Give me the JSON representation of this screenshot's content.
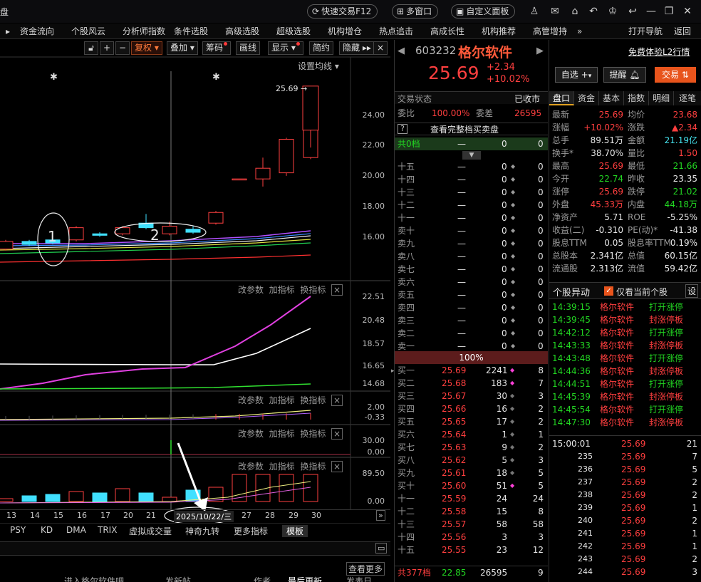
{
  "titlebar": {
    "left_glyph": "盘",
    "quick_trade": "快速交易F12",
    "multi_window": "多窗口",
    "custom_panel": "自定义面板"
  },
  "menu": [
    "资金流向",
    "个股风云",
    "分析师指数",
    "条件选股",
    "高级选股",
    "超级选股",
    "机构增仓",
    "热点追击",
    "高成长性",
    "机构推荐",
    "高管增持",
    "»",
    "打开导航",
    "返回"
  ],
  "chart_toolbar": {
    "fuquan": "复权",
    "diejia": "叠加",
    "chouma": "筹码",
    "huaxian": "画线",
    "xianshi": "显示",
    "jianyue": "简约",
    "yincang": "隐藏",
    "settings": "设置均线"
  },
  "price_axis": [
    "24.00",
    "22.00",
    "20.00",
    "18.00",
    "16.00"
  ],
  "price_marker": "25.69",
  "annotations": {
    "circle1": "1",
    "circle2": "2"
  },
  "panel_buttons": {
    "params": "改参数",
    "add": "加指标",
    "swap": "换指标",
    "close": "×"
  },
  "ind1_axis": [
    "22.51",
    "20.48",
    "18.57",
    "16.65",
    "14.68"
  ],
  "ind2_axis": [
    "2.00",
    "-0.33"
  ],
  "ind3_axis": [
    "30.00",
    "0.00"
  ],
  "ind4_axis": [
    "89.50",
    "0.00"
  ],
  "dates": [
    "13",
    "14",
    "15",
    "16",
    "17",
    "20",
    "21",
    "27",
    "28",
    "29",
    "30"
  ],
  "selected_date": "2025/10/22/三",
  "bottom_tabs": [
    "PSY",
    "KD",
    "DMA",
    "TRIX",
    "虚拟成交量",
    "神奇九转",
    "更多指标",
    "模板"
  ],
  "see_more": "查看更多",
  "bottom_cols": [
    "进入格尔软件吧",
    "发新帖",
    "作者",
    "最后更新",
    "发表日"
  ],
  "stock": {
    "code": "603232",
    "name": "格尔软件",
    "price": "25.69",
    "change": "+2.34",
    "pct": "+10.02%",
    "free_trial": "免费体验L2行情",
    "zixuan": "自选",
    "tixing": "提醒",
    "jiaoyi": "交易"
  },
  "status": {
    "label": "交易状态",
    "value": "已收市",
    "weibi_label": "委比",
    "weibi": "100.00%",
    "weicha_label": "委差",
    "weicha": "26595",
    "see_full": "查看完整档买卖盘",
    "total0_label": "共0档",
    "total0_a": "—",
    "total0_b": "0",
    "total0_c": "0"
  },
  "ask_rows": [
    {
      "l": "十五",
      "p": "—",
      "v": "0",
      "c": "0"
    },
    {
      "l": "十四",
      "p": "—",
      "v": "0",
      "c": "0"
    },
    {
      "l": "十三",
      "p": "—",
      "v": "0",
      "c": "0"
    },
    {
      "l": "十二",
      "p": "—",
      "v": "0",
      "c": "0"
    },
    {
      "l": "十一",
      "p": "—",
      "v": "0",
      "c": "0"
    },
    {
      "l": "卖十",
      "p": "—",
      "v": "0",
      "c": "0"
    },
    {
      "l": "卖九",
      "p": "—",
      "v": "0",
      "c": "0"
    },
    {
      "l": "卖八",
      "p": "—",
      "v": "0",
      "c": "0"
    },
    {
      "l": "卖七",
      "p": "—",
      "v": "0",
      "c": "0"
    },
    {
      "l": "卖六",
      "p": "—",
      "v": "0",
      "c": "0"
    },
    {
      "l": "卖五",
      "p": "—",
      "v": "0",
      "c": "0"
    },
    {
      "l": "卖四",
      "p": "—",
      "v": "0",
      "c": "0"
    },
    {
      "l": "卖三",
      "p": "—",
      "v": "0",
      "c": "0"
    },
    {
      "l": "卖二",
      "p": "—",
      "v": "0",
      "c": "0"
    },
    {
      "l": "卖一",
      "p": "—",
      "v": "0",
      "c": "0"
    }
  ],
  "mid_pct": "100%",
  "bid_rows": [
    {
      "l": "买一",
      "p": "25.69",
      "v": "2241",
      "c": "8",
      "m": "pink"
    },
    {
      "l": "买二",
      "p": "25.68",
      "v": "183",
      "c": "7",
      "m": "pink"
    },
    {
      "l": "买三",
      "p": "25.67",
      "v": "30",
      "c": "3",
      "m": "gray"
    },
    {
      "l": "买四",
      "p": "25.66",
      "v": "16",
      "c": "2",
      "m": "gray"
    },
    {
      "l": "买五",
      "p": "25.65",
      "v": "17",
      "c": "2",
      "m": "gray"
    },
    {
      "l": "买六",
      "p": "25.64",
      "v": "1",
      "c": "1",
      "m": "gray"
    },
    {
      "l": "买七",
      "p": "25.63",
      "v": "9",
      "c": "2",
      "m": "gray"
    },
    {
      "l": "买八",
      "p": "25.62",
      "v": "5",
      "c": "3",
      "m": "gray"
    },
    {
      "l": "买九",
      "p": "25.61",
      "v": "18",
      "c": "5",
      "m": "gray"
    },
    {
      "l": "买十",
      "p": "25.60",
      "v": "51",
      "c": "5",
      "m": "pink"
    },
    {
      "l": "十一",
      "p": "25.59",
      "v": "24",
      "c": "24",
      "m": ""
    },
    {
      "l": "十二",
      "p": "25.58",
      "v": "15",
      "c": "8",
      "m": ""
    },
    {
      "l": "十三",
      "p": "25.57",
      "v": "58",
      "c": "58",
      "m": ""
    },
    {
      "l": "十四",
      "p": "25.56",
      "v": "3",
      "c": "3",
      "m": ""
    },
    {
      "l": "十五",
      "p": "25.55",
      "v": "23",
      "c": "12",
      "m": ""
    }
  ],
  "total_bid": {
    "label": "共377档",
    "a": "22.85",
    "b": "26595",
    "c": "9"
  },
  "quote_tabs": [
    "盘口",
    "资金",
    "基本",
    "指数",
    "明细",
    "逐笔"
  ],
  "quote": [
    {
      "l1": "最新",
      "v1": "25.69",
      "c1": "red",
      "l2": "均价",
      "v2": "23.68",
      "c2": "red"
    },
    {
      "l1": "涨幅",
      "v1": "+10.02%",
      "c1": "red",
      "l2": "涨跌",
      "v2": "▲2.34",
      "c2": "red"
    },
    {
      "l1": "总手",
      "v1": "89.51万",
      "c1": "white",
      "l2": "金额",
      "v2": "21.19亿",
      "c2": "cyan"
    },
    {
      "l1": "换手*",
      "v1": "38.70%",
      "c1": "white",
      "l2": "量比",
      "v2": "1.50",
      "c2": "red"
    },
    {
      "l1": "最高",
      "v1": "25.69",
      "c1": "red",
      "l2": "最低",
      "v2": "21.66",
      "c2": "green"
    },
    {
      "l1": "今开",
      "v1": "22.74",
      "c1": "green",
      "l2": "昨收",
      "v2": "23.35",
      "c2": "white"
    },
    {
      "l1": "涨停",
      "v1": "25.69",
      "c1": "red",
      "l2": "跌停",
      "v2": "21.02",
      "c2": "green"
    },
    {
      "l1": "外盘",
      "v1": "45.33万",
      "c1": "red",
      "l2": "内盘",
      "v2": "44.18万",
      "c2": "green"
    },
    {
      "l1": "净资产",
      "v1": "5.71",
      "c1": "white",
      "l2": "ROE",
      "v2": "-5.25%",
      "c2": "white"
    },
    {
      "l1": "收益(二)",
      "v1": "-0.310",
      "c1": "white",
      "l2": "PE(动)*",
      "v2": "-41.38",
      "c2": "white"
    },
    {
      "l1": "股息TTM",
      "v1": "0.05",
      "c1": "white",
      "l2": "股息率TTM",
      "v2": "0.19%",
      "c2": "white"
    },
    {
      "l1": "总股本",
      "v1": "2.341亿",
      "c1": "white",
      "l2": "总值",
      "v2": "60.15亿",
      "c2": "white"
    },
    {
      "l1": "流通股",
      "v1": "2.313亿",
      "c1": "white",
      "l2": "流值",
      "v2": "59.42亿",
      "c2": "white"
    }
  ],
  "movement": {
    "title": "个股异动",
    "only_current": "仅看当前个股",
    "settings": "设"
  },
  "movements": [
    {
      "t": "14:39:15",
      "n": "格尔软件",
      "e": "打开涨停",
      "c": "green"
    },
    {
      "t": "14:39:45",
      "n": "格尔软件",
      "e": "封涨停板",
      "c": "red"
    },
    {
      "t": "14:42:12",
      "n": "格尔软件",
      "e": "打开涨停",
      "c": "green"
    },
    {
      "t": "14:43:33",
      "n": "格尔软件",
      "e": "封涨停板",
      "c": "red"
    },
    {
      "t": "14:43:48",
      "n": "格尔软件",
      "e": "打开涨停",
      "c": "green"
    },
    {
      "t": "14:44:36",
      "n": "格尔软件",
      "e": "封涨停板",
      "c": "red"
    },
    {
      "t": "14:44:51",
      "n": "格尔软件",
      "e": "打开涨停",
      "c": "green"
    },
    {
      "t": "14:45:39",
      "n": "格尔软件",
      "e": "封涨停板",
      "c": "red"
    },
    {
      "t": "14:45:54",
      "n": "格尔软件",
      "e": "打开涨停",
      "c": "green"
    },
    {
      "t": "14:47:30",
      "n": "格尔软件",
      "e": "封涨停板",
      "c": "red"
    }
  ],
  "ticks": [
    {
      "t": "15:00:01",
      "p": "25.69",
      "v": "21"
    },
    {
      "t": "235",
      "p": "25.69",
      "v": "7"
    },
    {
      "t": "236",
      "p": "25.69",
      "v": "5"
    },
    {
      "t": "237",
      "p": "25.69",
      "v": "2"
    },
    {
      "t": "238",
      "p": "25.69",
      "v": "2"
    },
    {
      "t": "239",
      "p": "25.69",
      "v": "1"
    },
    {
      "t": "240",
      "p": "25.69",
      "v": "2"
    },
    {
      "t": "241",
      "p": "25.69",
      "v": "1"
    },
    {
      "t": "242",
      "p": "25.69",
      "v": "1"
    },
    {
      "t": "243",
      "p": "25.69",
      "v": "2"
    },
    {
      "t": "244",
      "p": "25.69",
      "v": "3"
    }
  ],
  "candles": [
    {
      "o": 15.0,
      "c": 15.5,
      "h": 15.6,
      "l": 14.9,
      "up": true
    },
    {
      "o": 15.3,
      "c": 15.5,
      "h": 15.6,
      "l": 15.2,
      "up": false
    },
    {
      "o": 15.4,
      "c": 15.6,
      "h": 15.7,
      "l": 15.3,
      "up": false
    },
    {
      "o": 15.6,
      "c": 16.4,
      "h": 16.5,
      "l": 15.5,
      "up": true
    },
    {
      "o": 15.9,
      "c": 16.0,
      "h": 16.1,
      "l": 15.8,
      "up": false
    },
    {
      "o": 16.0,
      "c": 16.4,
      "h": 16.5,
      "l": 15.9,
      "up": true
    },
    {
      "o": 16.4,
      "c": 16.7,
      "h": 17.3,
      "l": 16.3,
      "up": false
    },
    {
      "o": 16.0,
      "c": 16.5,
      "h": 16.8,
      "l": 15.9,
      "up": true
    },
    {
      "o": 16.1,
      "c": 16.3,
      "h": 16.5,
      "l": 16.0,
      "up": false
    },
    {
      "o": 16.7,
      "c": 17.4,
      "h": 17.5,
      "l": 16.6,
      "up": true
    },
    {
      "o": 19.6,
      "c": 19.6,
      "h": 19.6,
      "l": 19.6,
      "up": true
    },
    {
      "o": 19.6,
      "c": 20.3,
      "h": 21.0,
      "l": 19.1,
      "up": true
    },
    {
      "o": 20.0,
      "c": 22.2,
      "h": 22.3,
      "l": 19.8,
      "up": true
    },
    {
      "o": 21.0,
      "c": 23.4,
      "h": 24.5,
      "l": 20.9,
      "up": true
    },
    {
      "o": 22.8,
      "c": 25.69,
      "h": 25.69,
      "l": 21.66,
      "up": true
    }
  ]
}
